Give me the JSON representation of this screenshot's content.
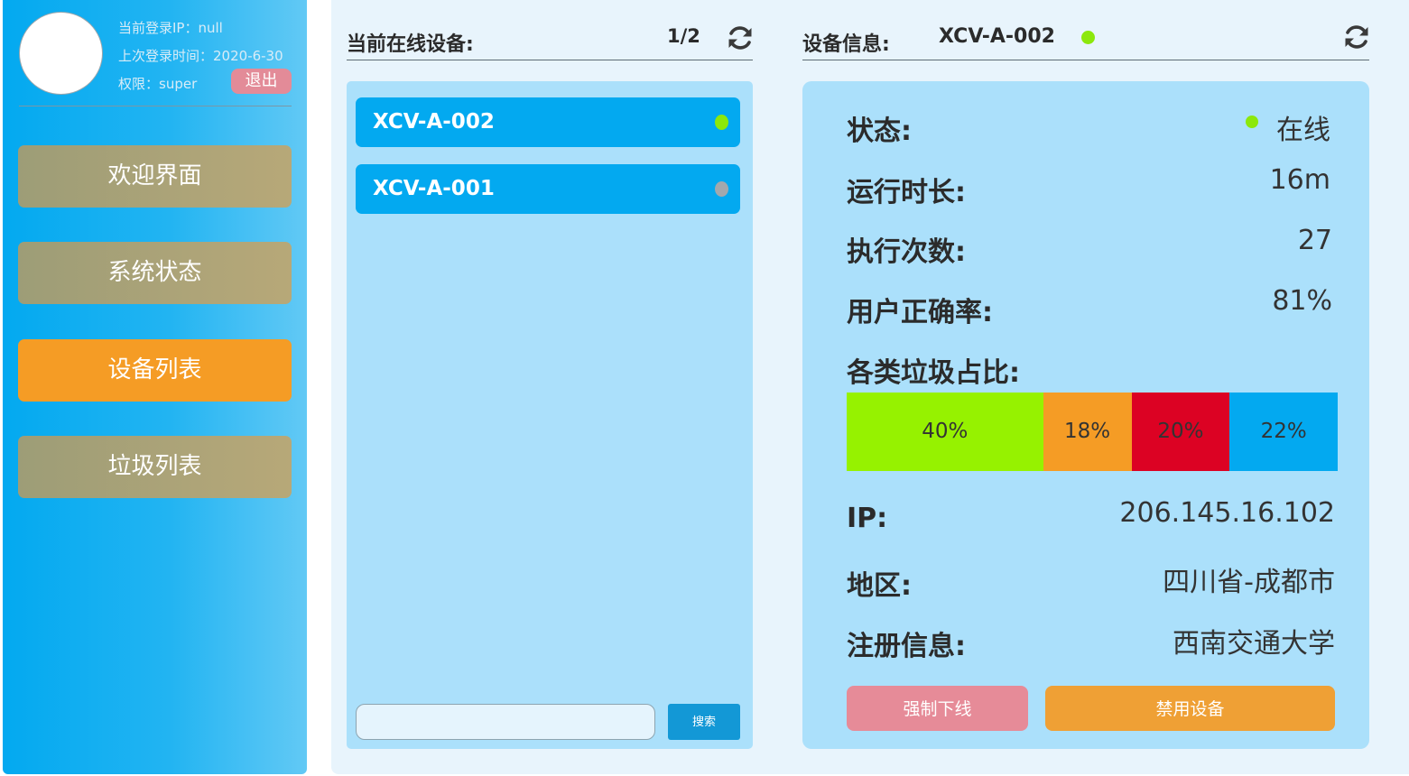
{
  "sidebar": {
    "user": {
      "ip_label": "当前登录IP：",
      "ip_value": "null",
      "last_login_label": "上次登录时间：",
      "last_login_value": "2020-6-30",
      "role_label": "权限：",
      "role_value": "super"
    },
    "logout_label": "退出",
    "nav": [
      {
        "label": "欢迎界面",
        "active": false
      },
      {
        "label": "系统状态",
        "active": false
      },
      {
        "label": "设备列表",
        "active": true
      },
      {
        "label": "垃圾列表",
        "active": false
      }
    ]
  },
  "online_devices": {
    "title": "当前在线设备:",
    "page": "1/2",
    "refresh_icon": "refresh-icon",
    "items": [
      {
        "name": "XCV-A-002",
        "status_color": "#8ce80c"
      },
      {
        "name": "XCV-A-001",
        "status_color": "#a2a8ad"
      }
    ],
    "search": {
      "value": "",
      "placeholder": ""
    },
    "search_button": "搜索"
  },
  "device_info": {
    "title": "设备信息:",
    "device_name": "XCV-A-002",
    "status_color": "#8ce80c",
    "refresh_icon": "refresh-icon",
    "status_label": "状态:",
    "status_value": "在线",
    "runtime_label": "运行时长:",
    "runtime_value": "16m",
    "exec_count_label": "执行次数:",
    "exec_count_value": "27",
    "accuracy_label": "用户正确率:",
    "accuracy_value": "81%",
    "ratio_label": "各类垃圾占比:",
    "ratio": [
      {
        "percent": 40,
        "text": "40%",
        "color": "#96f200"
      },
      {
        "percent": 18,
        "text": "18%",
        "color": "#f59c25"
      },
      {
        "percent": 20,
        "text": "20%",
        "color": "#dc0223"
      },
      {
        "percent": 22,
        "text": "22%",
        "color": "#03a9f0"
      }
    ],
    "ip_label": "IP:",
    "ip_value": "206.145.16.102",
    "region_label": "地区:",
    "region_value": "四川省-成都市",
    "register_label": "注册信息:",
    "register_value": "西南交通大学",
    "force_offline_label": "强制下线",
    "disable_label": "禁用设备"
  }
}
